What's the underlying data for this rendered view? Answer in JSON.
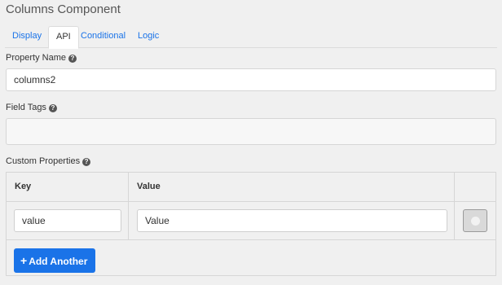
{
  "header": {
    "title": "Columns Component"
  },
  "tabs": [
    {
      "label": "Display",
      "active": false
    },
    {
      "label": "API",
      "active": true
    },
    {
      "label": "Conditional",
      "active": false
    },
    {
      "label": "Logic",
      "active": false
    }
  ],
  "property_name": {
    "label": "Property Name",
    "value": "columns2",
    "help": "?"
  },
  "field_tags": {
    "label": "Field Tags",
    "value": "",
    "help": "?"
  },
  "custom_properties": {
    "label": "Custom Properties",
    "help": "?",
    "columns": [
      "Key",
      "Value"
    ],
    "rows": [
      {
        "key": "value",
        "value": "Value"
      }
    ],
    "add_label": "Add Another",
    "add_icon": "+"
  },
  "colors": {
    "accent": "#1a73e8",
    "background": "#f0f0f0"
  }
}
